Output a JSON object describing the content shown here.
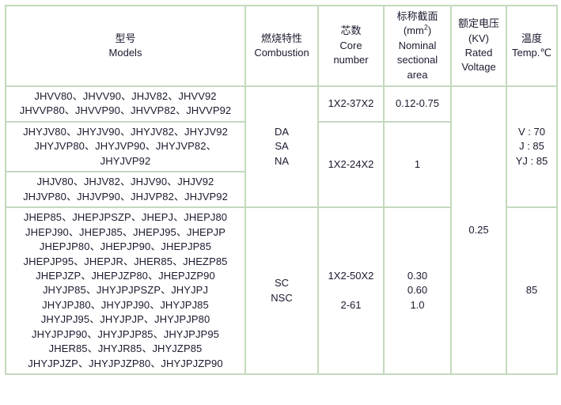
{
  "table": {
    "headers": [
      {
        "zh": "型号",
        "en": "Models"
      },
      {
        "zh": "燃烧特性",
        "en": "Combustion"
      },
      {
        "zh": "芯数",
        "en1": "Core",
        "en2": "number"
      },
      {
        "zh": "标称截面",
        "unit_pre": "(mm",
        "unit_sup": "2",
        "unit_post": ")",
        "en1": "Nominal",
        "en2": "sectional",
        "en3": "area"
      },
      {
        "zh": "额定电压",
        "unit": "(KV)",
        "en1": "Rated",
        "en2": "Voltage"
      },
      {
        "zh": "温度",
        "en": "Temp.℃"
      }
    ],
    "rows": [
      {
        "models": [
          "JHVV80、JHVV90、JHJV82、JHVV92",
          "JHVVP80、JHVVP90、JHVVP82、JHVVP92"
        ],
        "core": "1X2-37X2",
        "area": "0.12-0.75"
      },
      {
        "models": [
          "JHYJV80、JHYJV90、JHYJV82、JHYJV92",
          "JHYJVP80、JHYJVP90、JHYJVP82、",
          "JHYJVP92"
        ],
        "core": "1X2-24X2",
        "area": "1"
      },
      {
        "models": [
          "JHJV80、JHJV82、JHJV90、JHJV92",
          "JHJVP80、JHJVP90、JHJVP82、JHJVP92"
        ]
      },
      {
        "models": [
          "JHEP85、JHEPJPSZP、JHEPJ、JHEPJ80",
          "JHEPJ90、JHEPJ85、JHEPJ95、JHEPJP",
          "JHEPJP80、JHEPJP90、JHEPJP85",
          "JHEPJP95、JHEPJR、JHER85、JHEZP85",
          "JHEPJZP、JHEPJZP80、JHEPJZP90",
          "JHYJP85、JHYJPJPSZP、JHYJPJ",
          "JHYJPJ80、JHYJPJ90、JHYJPJ85",
          "JHYJPJ95、JHYJPJP、JHYJPJP80",
          "JHYJPJP90、JHYJPJP85、JHYJPJP95",
          "JHER85、JHYJR85、JHYJZP85",
          "JHYJPJZP、JHYJPJZP80、JHYJPJZP90"
        ],
        "core_1": "1X2-50X2",
        "core_2": "2-61",
        "area_lines": [
          "0.30",
          "0.60",
          "1.0"
        ]
      }
    ],
    "combustion_top": [
      "DA",
      "SA",
      "NA"
    ],
    "combustion_bottom": [
      "SC",
      "NSC"
    ],
    "voltage_value": "0.25",
    "temp_top": [
      "V : 70",
      "J : 85",
      "YJ : 85"
    ],
    "temp_bottom": "85"
  },
  "colors": {
    "border": "#c3d9bd",
    "text": "#1a1a2e",
    "background": "#ffffff"
  }
}
